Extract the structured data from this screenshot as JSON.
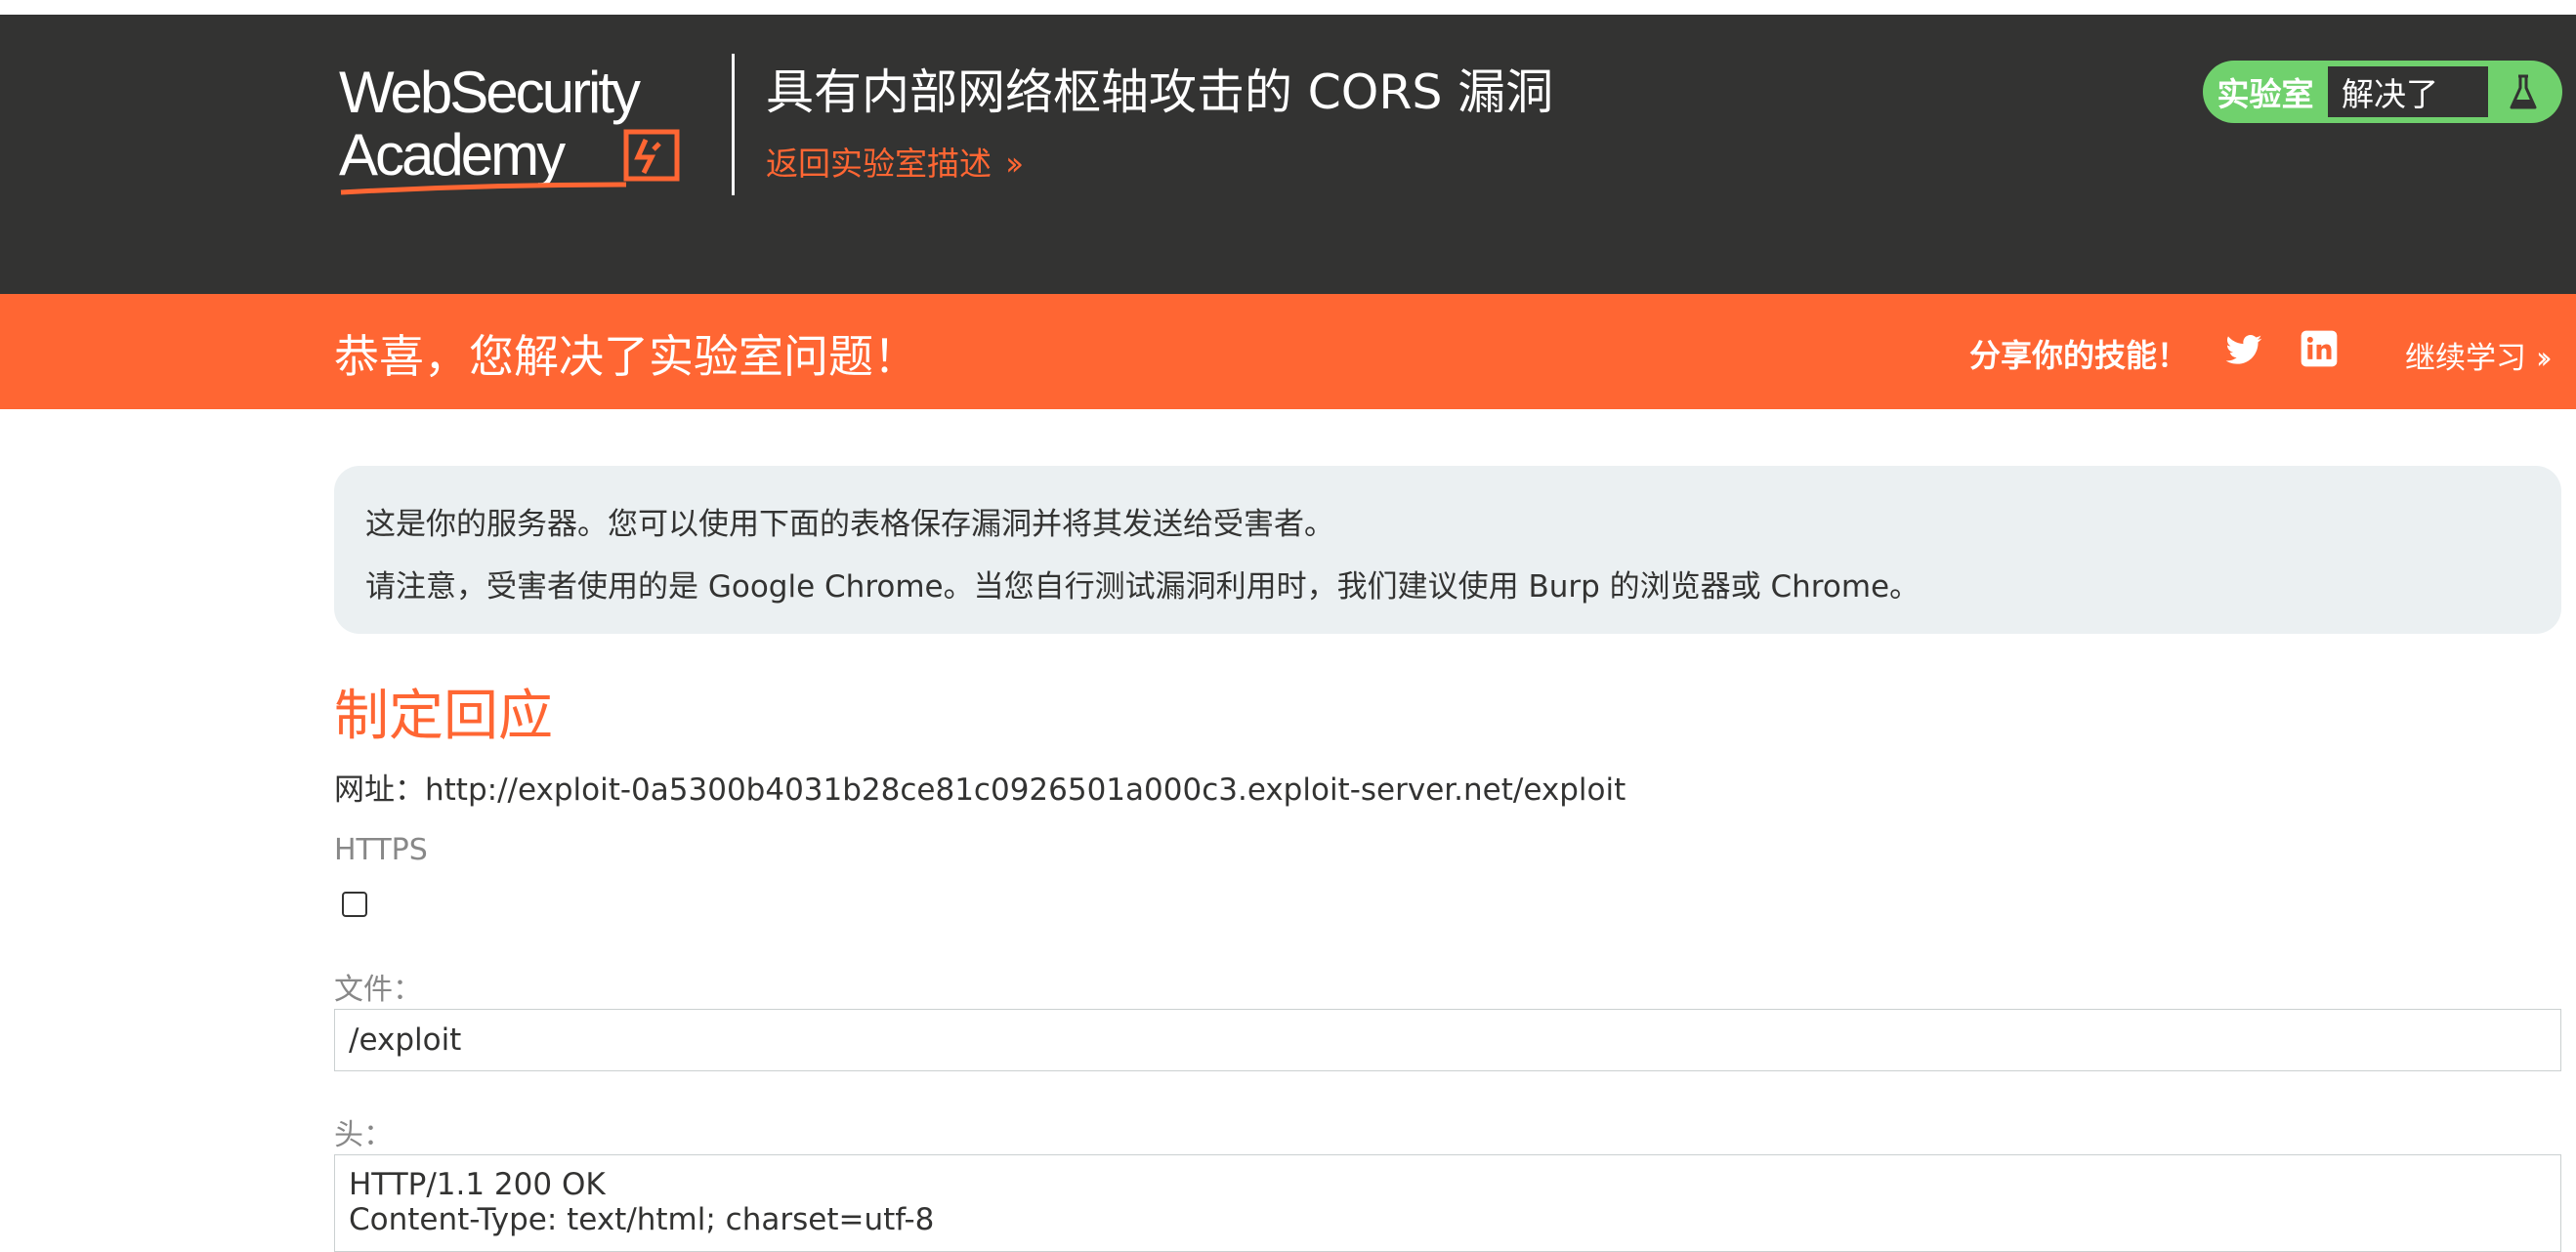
{
  "header": {
    "logo": {
      "line1": "WebSecurity",
      "line2": "Academy"
    },
    "lab_title": "具有内部网络枢轴攻击的 CORS 漏洞",
    "back_link": "返回实验室描述",
    "lab_status": {
      "label": "实验室",
      "state": "解决了"
    }
  },
  "banner": {
    "message": "恭喜，您解决了实验室问题！",
    "share_label": "分享你的技能！",
    "continue_label": "继续学习"
  },
  "info": {
    "line1": "这是你的服务器。您可以使用下面的表格保存漏洞并将其发送给受害者。",
    "line2": "请注意，受害者使用的是 Google Chrome。当您自行测试漏洞利用时，我们建议使用 Burp 的浏览器或 Chrome。"
  },
  "form": {
    "title": "制定回应",
    "url_label": "网址：",
    "url_value": "http://exploit-0a5300b4031b28ce81c0926501a000c3.exploit-server.net/exploit",
    "https_label": "HTTPS",
    "https_checked": false,
    "file_label": "文件：",
    "file_value": "/exploit",
    "head_label": "头：",
    "head_lines": [
      "HTTP/1.1 200 OK",
      "Content-Type: text/html; charset=utf-8"
    ]
  },
  "colors": {
    "header_bg": "#333332",
    "accent_orange": "#ff6633",
    "solved_green": "#70d16d",
    "info_bg": "#ebf0f2"
  },
  "icons": [
    "flask-icon",
    "twitter-icon",
    "linkedin-icon",
    "chevron-double-right-icon"
  ]
}
